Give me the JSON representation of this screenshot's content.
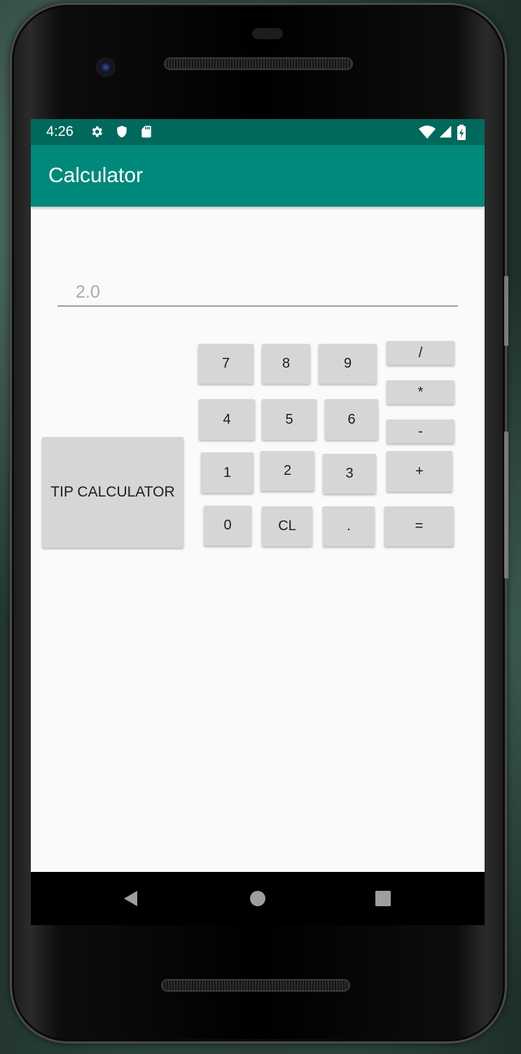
{
  "status_bar": {
    "time": "4:26",
    "left_icons": [
      "settings-gear-icon",
      "shield-icon",
      "sd-card-icon"
    ],
    "right_icons": [
      "wifi-icon",
      "cell-signal-icon",
      "battery-charging-icon"
    ]
  },
  "app_bar": {
    "title": "Calculator"
  },
  "display": {
    "placeholder": "2.0",
    "value": ""
  },
  "buttons": {
    "tip_calculator": "TIP CALCULATOR",
    "seven": "7",
    "eight": "8",
    "nine": "9",
    "divide": "/",
    "multiply": "*",
    "four": "4",
    "five": "5",
    "six": "6",
    "subtract": "-",
    "one": "1",
    "two": "2",
    "three": "3",
    "add": "+",
    "zero": "0",
    "clear": "CL",
    "decimal": ".",
    "equals": "="
  },
  "nav_bar": {
    "icons": [
      "back-icon",
      "home-icon",
      "recents-icon"
    ]
  },
  "colors": {
    "status_bar": "#00695c",
    "app_bar": "#00897b",
    "button": "#d6d6d6",
    "screen_bg": "#fafafa"
  }
}
